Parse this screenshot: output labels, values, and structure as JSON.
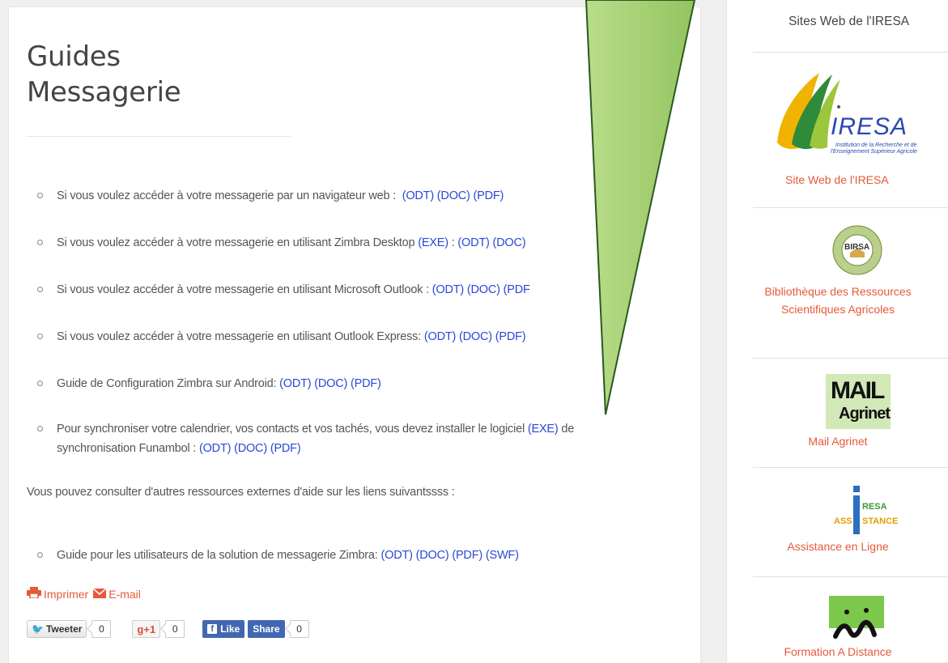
{
  "title": {
    "line1": "Guides",
    "line2": "Messagerie"
  },
  "guides": [
    {
      "text": "Si vous voulez accéder à votre messagerie par un navigateur web :",
      "links": [
        "(ODT)",
        "(DOC)",
        "(PDF)"
      ]
    },
    {
      "text_before": "Si vous voulez accéder à votre messagerie en utilisant Zimbra Desktop",
      "exe": "(EXE)",
      "text_after": ":",
      "links": [
        "(ODT)",
        "(DOC)"
      ]
    },
    {
      "text": "Si vous voulez accéder à votre messagerie en utilisant Microsoft Outlook :",
      "links": [
        "(ODT)",
        "(DOC)",
        "(PDF"
      ]
    },
    {
      "text": "Si vous voulez accéder à votre messagerie en utilisant Outlook Express:",
      "links": [
        "(ODT)",
        "(DOC)",
        "(PDF)"
      ]
    },
    {
      "text": "Guide de Configuration Zimbra sur Android:",
      "links": [
        "(ODT)",
        "(DOC)",
        "(PDF)"
      ]
    },
    {
      "text_before": "Pour synchroniser votre calendrier, vos contacts et vos tachés, vous devez installer le logiciel",
      "exe": "(EXE)",
      "text_after": "de",
      "line2": "synchronisation Funambol :",
      "links": [
        "(ODT)",
        "(DOC)",
        "(PDF)"
      ]
    }
  ],
  "intro": "Vous pouvez consulter d'autres ressources externes d'aide sur les liens suivantssss :",
  "external": {
    "text": "Guide pour les utilisateurs de la solution de messagerie Zimbra:",
    "links": [
      "(ODT)",
      "(DOC)",
      "(PDF)",
      "(SWF)"
    ]
  },
  "actions": {
    "print": "Imprimer",
    "email": "E-mail"
  },
  "share": {
    "tweet": "Tweeter",
    "tweet_count": "0",
    "gplus": "+1",
    "gplus_count": "0",
    "like": "Like",
    "share": "Share",
    "fb_count": "0"
  },
  "sidebar": {
    "title": "Sites Web de l'IRESA",
    "iresa_logo": {
      "name": "IRESA",
      "tagline1": "Institution de la Recherche et de",
      "tagline2": "l'Enseignement Supérieur Agricole"
    },
    "iresa_label": "Site Web de l'IRESA",
    "birsa_logo": "BIRSA",
    "birsa_label1": "Bibliothèque des Ressources",
    "birsa_label2": "Scientifiques Agricoles",
    "mail_logo": {
      "top": "MAIL",
      "bottom": "Agrinet"
    },
    "mail_label": "Mail Agrinet",
    "assist_logo": {
      "top": "RESA",
      "left": "ASS",
      "right": "STANCE"
    },
    "assist_label": "Assistance en Ligne",
    "fad_label": "Formation A Distance"
  },
  "colors": {
    "link": "#2a48d6",
    "accent": "#e45a3a",
    "arrow": "#9fcc6a"
  }
}
